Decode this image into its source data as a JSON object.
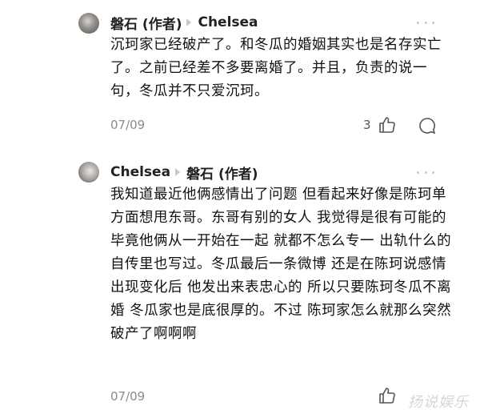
{
  "comments": [
    {
      "author": "磐石 (作者)",
      "reply_to": "Chelsea",
      "text": "沉珂家已经破产了。和冬瓜的婚姻其实也是名存实亡了。之前已经差不多要离婚了。并且，负责的说一句，冬瓜并不只爱沉珂。",
      "date": "07/09",
      "likes": "3",
      "avatar": "cat-avatar"
    },
    {
      "author": "Chelsea",
      "reply_to": "磐石 (作者)",
      "text": "我知道最近他俩感情出了问题 但看起来好像是陈珂单方面想甩东哥。东哥有别的女人 我觉得是很有可能的 毕竟他俩从一开始在一起 就都不怎么专一 出轨什么的自传里也写过。冬瓜最后一条微博 还是在陈珂说感情出现变化后 他发出来表忠心的 所以只要陈珂冬瓜不离婚 冬瓜家也是底很厚的。不过 陈珂家怎么就那么突然破产了啊啊啊",
      "date": "07/09",
      "likes": "",
      "avatar": "person-avatar"
    }
  ],
  "icons": {
    "like": "thumbs-up-icon",
    "reply": "comment-bubble-icon",
    "more": "more-dots-icon"
  },
  "watermark": "扬说娱乐"
}
